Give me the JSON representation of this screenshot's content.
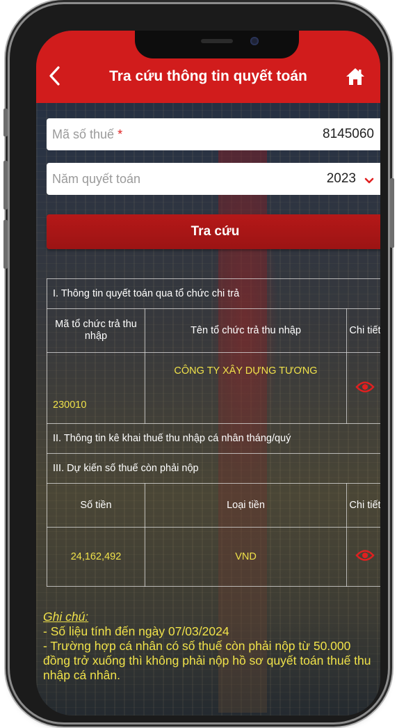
{
  "header": {
    "title": "Tra cứu thông tin quyết toán",
    "back_icon": "chevron-left-icon",
    "home_icon": "home-icon"
  },
  "form": {
    "tax_code": {
      "label": "Mã số thuế",
      "required_mark": "*",
      "value": "8145060"
    },
    "year": {
      "label": "Năm quyết toán",
      "value": "2023"
    },
    "search_label": "Tra cứu"
  },
  "section1": {
    "title": "I. Thông tin quyết toán qua tổ chức chi trả",
    "columns": [
      "Mã tổ chức trả thu nhập",
      "Tên tổ chức trả thu nhập",
      "Chi tiết"
    ],
    "rows": [
      {
        "code": "230010",
        "name": "CÔNG TY XÂY DỰNG TƯƠNG"
      }
    ]
  },
  "section2": {
    "title": "II. Thông tin kê khai thuế thu nhập cá nhân tháng/quý"
  },
  "section3": {
    "title": "III. Dự kiến số thuế còn phải nộp",
    "columns": [
      "Số tiền",
      "Loại tiền",
      "Chi tiết"
    ],
    "rows": [
      {
        "amount": "24,162,492",
        "currency": "VND"
      }
    ]
  },
  "note": {
    "heading": "Ghi chú:",
    "line1": "- Số liệu tính đến ngày 07/03/2024",
    "line2": "- Trường hợp cá nhân có số thuế còn phải nộp từ 50.000 đồng trở xuống thì không phải nộp hồ sơ quyết toán thuế thu nhập cá nhân."
  },
  "colors": {
    "header_red": "#d11c1c",
    "accent_yellow": "#f0e24a",
    "eye_red": "#e02020"
  }
}
